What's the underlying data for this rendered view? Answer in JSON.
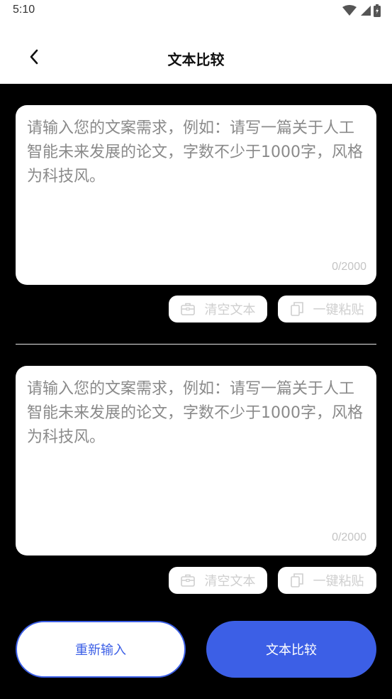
{
  "status_bar": {
    "time": "5:10",
    "icons": [
      "wifi-icon",
      "signal-icon",
      "battery-icon"
    ]
  },
  "header": {
    "title": "文本比较",
    "back_icon": "chevron-left-icon"
  },
  "inputs": [
    {
      "placeholder": "请输入您的文案需求，例如：请写一篇关于人工智能未来发展的论文，字数不少于1000字，风格为科技风。",
      "value": "",
      "counter": "0/2000",
      "clear_label": "清空文本",
      "paste_label": "一键粘贴"
    },
    {
      "placeholder": "请输入您的文案需求，例如：请写一篇关于人工智能未来发展的论文，字数不少于1000字，风格为科技风。",
      "value": "",
      "counter": "0/2000",
      "clear_label": "清空文本",
      "paste_label": "一键粘贴"
    }
  ],
  "actions": {
    "reset_label": "重新输入",
    "compare_label": "文本比较"
  },
  "colors": {
    "accent": "#3c5fe6",
    "background": "#000000",
    "card": "#ffffff",
    "muted_text": "#cfcfcf"
  }
}
